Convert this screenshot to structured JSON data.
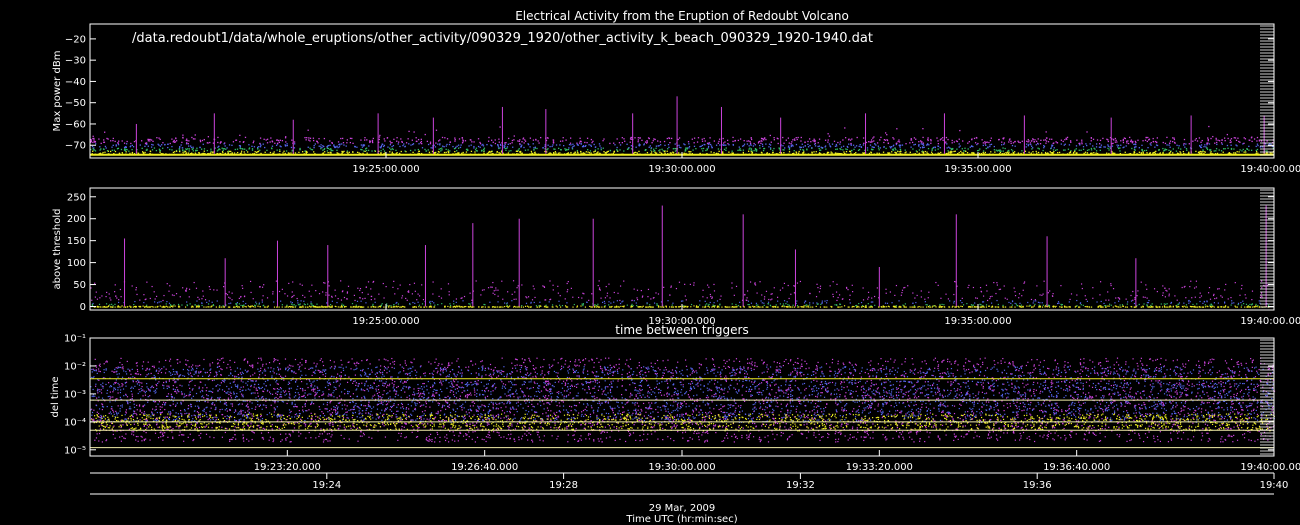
{
  "title": "Electrical Activity from the Eruption of Redoubt Volcano",
  "file_path": "/data.redoubt1/data/whole_eruptions/other_activity/090329_1920/other_activity_k_beach_090329_1920-1940.dat",
  "date_label": "29 Mar, 2009",
  "time_axis_label": "Time UTC (hr:min:sec)",
  "colors": {
    "background": "#000000",
    "axes": "#ffffff",
    "magenta": "#cc44dd",
    "blue": "#5566ee",
    "green": "#33bb66",
    "yellow": "#eeee22"
  },
  "chart_data": [
    {
      "type": "scatter",
      "id": "max-power",
      "title": "",
      "ylabel": "Max power dBm",
      "ylim": [
        -76,
        -13
      ],
      "yticks": [
        -20,
        -30,
        -40,
        -50,
        -60,
        -70
      ],
      "ytick_labels": [
        "−20",
        "−30",
        "−40",
        "−50",
        "−60",
        "−70"
      ],
      "xlim": [
        "19:20:00",
        "19:40:00"
      ],
      "xtick_labels": [
        "19:25:00.000",
        "19:30:00.000",
        "19:35:00.000",
        "19:40:00.000"
      ],
      "xticks": [
        "19:25:00",
        "19:30:00",
        "19:35:00",
        "19:40:00"
      ],
      "baseline": -74,
      "noise_top": -66,
      "peaks": [
        {
          "x": "19:20:47",
          "y": -60
        },
        {
          "x": "19:22:06",
          "y": -55
        },
        {
          "x": "19:23:26",
          "y": -58
        },
        {
          "x": "19:24:52",
          "y": -55
        },
        {
          "x": "19:25:48",
          "y": -57
        },
        {
          "x": "19:26:58",
          "y": -52
        },
        {
          "x": "19:27:42",
          "y": -53
        },
        {
          "x": "19:29:10",
          "y": -55
        },
        {
          "x": "19:29:55",
          "y": -47
        },
        {
          "x": "19:30:40",
          "y": -52
        },
        {
          "x": "19:31:40",
          "y": -57
        },
        {
          "x": "19:33:06",
          "y": -55
        },
        {
          "x": "19:34:26",
          "y": -55
        },
        {
          "x": "19:35:47",
          "y": -56
        },
        {
          "x": "19:37:15",
          "y": -57
        },
        {
          "x": "19:38:36",
          "y": -56
        },
        {
          "x": "19:39:50",
          "y": -56
        }
      ]
    },
    {
      "type": "scatter",
      "id": "above-threshold",
      "title": "",
      "ylabel": "above threshold",
      "ylim": [
        -8,
        270
      ],
      "yticks": [
        0,
        50,
        100,
        150,
        200,
        250
      ],
      "ytick_labels": [
        "0",
        "50",
        "100",
        "150",
        "200",
        "250"
      ],
      "xlim": [
        "19:20:00",
        "19:40:00"
      ],
      "xtick_labels": [
        "19:25:00.000",
        "19:30:00.000",
        "19:35:00.000",
        "19:40:00.000"
      ],
      "xticks": [
        "19:25:00",
        "19:30:00",
        "19:35:00",
        "19:40:00"
      ],
      "peaks": [
        {
          "x": "19:20:35",
          "y": 155
        },
        {
          "x": "19:22:17",
          "y": 110
        },
        {
          "x": "19:23:10",
          "y": 150
        },
        {
          "x": "19:24:01",
          "y": 140
        },
        {
          "x": "19:25:40",
          "y": 140
        },
        {
          "x": "19:26:28",
          "y": 190
        },
        {
          "x": "19:27:15",
          "y": 200
        },
        {
          "x": "19:28:30",
          "y": 200
        },
        {
          "x": "19:29:40",
          "y": 230
        },
        {
          "x": "19:31:02",
          "y": 210
        },
        {
          "x": "19:31:55",
          "y": 130
        },
        {
          "x": "19:33:20",
          "y": 90
        },
        {
          "x": "19:34:38",
          "y": 210
        },
        {
          "x": "19:36:10",
          "y": 160
        },
        {
          "x": "19:37:40",
          "y": 110
        },
        {
          "x": "19:39:52",
          "y": 230
        }
      ]
    },
    {
      "type": "scatter",
      "id": "time-between-triggers",
      "title": "time between triggers",
      "ylabel": "del time",
      "yscale": "log",
      "ylim": [
        6e-06,
        0.1
      ],
      "yticks": [
        0.1,
        0.01,
        0.001,
        0.0001,
        1e-05,
        1e-06
      ],
      "ytick_labels": [
        "10⁻¹",
        "10⁻²",
        "10⁻³",
        "10⁻⁴",
        "10⁻⁵",
        "10⁻⁶"
      ],
      "xlim": [
        "19:20:00",
        "19:40:00"
      ],
      "xtick_labels": [
        "19:23:20.000",
        "19:26:40.000",
        "19:30:00.000",
        "19:33:20.000",
        "19:36:40.000",
        "19:40:00.000"
      ],
      "xticks": [
        "19:23:20",
        "19:26:40",
        "19:30:00",
        "19:33:20",
        "19:36:40",
        "19:40:00"
      ],
      "bands": [
        {
          "color": "magenta",
          "low": 2e-05,
          "high": 0.02
        },
        {
          "color": "blue",
          "low": 0.0001,
          "high": 0.01
        },
        {
          "color": "yellow",
          "low": 5e-05,
          "high": 0.0002
        }
      ],
      "lines": [
        0.0035,
        0.0006,
        0.0001,
        5e-05,
        1.2e-05
      ]
    }
  ],
  "time_axis": {
    "xlim": [
      "19:20:00",
      "19:40:00"
    ],
    "ticks": [
      "19:24",
      "19:28",
      "19:32",
      "19:36",
      "19:40"
    ]
  }
}
